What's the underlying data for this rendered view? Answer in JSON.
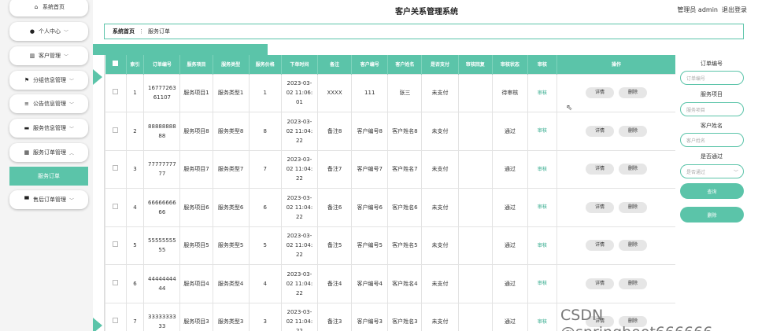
{
  "header": {
    "title": "客户关系管理系统",
    "user_label": "管理员 admin",
    "logout": "退出登录"
  },
  "sidebar": {
    "items": [
      {
        "icon": "home-icon",
        "label": "系统首页",
        "chevron": ""
      },
      {
        "icon": "user-icon",
        "label": "个人中心",
        "chevron": "﹀"
      },
      {
        "icon": "customer-icon",
        "label": "客户管理",
        "chevron": "﹀"
      },
      {
        "icon": "flag-icon",
        "label": "分组信息管理",
        "chevron": "﹀"
      },
      {
        "icon": "list-icon",
        "label": "公告信息管理",
        "chevron": "﹀"
      },
      {
        "icon": "monitor-icon",
        "label": "服务信息管理",
        "chevron": "﹀"
      },
      {
        "icon": "grid-icon",
        "label": "服务订单管理",
        "chevron": "︿"
      },
      {
        "icon": "bag-icon",
        "label": "售后订单管理",
        "chevron": "﹀"
      }
    ],
    "active_sub": "服务订单"
  },
  "breadcrumb": {
    "home": "系统首页",
    "sep": "⋮",
    "current": "服务订单"
  },
  "table": {
    "columns": [
      "索引",
      "订单编号",
      "服务项目",
      "服务类型",
      "服务价格",
      "下单时间",
      "备注",
      "客户编号",
      "客户姓名",
      "是否支付",
      "审核回复",
      "审核状态",
      "审核",
      "操作"
    ],
    "review_link": "审核",
    "detail_btn": "详情",
    "delete_btn": "删除",
    "rows": [
      {
        "idx": "1",
        "order_no": [
          "16777263",
          "61107"
        ],
        "item": "服务项目1",
        "type": "服务类型1",
        "price": "1",
        "time": [
          "2023-03-",
          "02 11:06:",
          "01"
        ],
        "note": "XXXX",
        "cust_no": "111",
        "cust_name": "张三",
        "paid": "未支付",
        "reply": "",
        "status": "待审核"
      },
      {
        "idx": "2",
        "order_no": [
          "88888888",
          "88"
        ],
        "item": "服务项目8",
        "type": "服务类型8",
        "price": "8",
        "time": [
          "2023-03-",
          "02 11:04:",
          "22"
        ],
        "note": "备注8",
        "cust_no": "客户编号8",
        "cust_name": "客户姓名8",
        "paid": "未支付",
        "reply": "",
        "status": "通过"
      },
      {
        "idx": "3",
        "order_no": [
          "77777777",
          "77"
        ],
        "item": "服务项目7",
        "type": "服务类型7",
        "price": "7",
        "time": [
          "2023-03-",
          "02 11:04:",
          "22"
        ],
        "note": "备注7",
        "cust_no": "客户编号7",
        "cust_name": "客户姓名7",
        "paid": "未支付",
        "reply": "",
        "status": "通过"
      },
      {
        "idx": "4",
        "order_no": [
          "66666666",
          "66"
        ],
        "item": "服务项目6",
        "type": "服务类型6",
        "price": "6",
        "time": [
          "2023-03-",
          "02 11:04:",
          "22"
        ],
        "note": "备注6",
        "cust_no": "客户编号6",
        "cust_name": "客户姓名6",
        "paid": "未支付",
        "reply": "",
        "status": "通过"
      },
      {
        "idx": "5",
        "order_no": [
          "55555555",
          "55"
        ],
        "item": "服务项目5",
        "type": "服务类型5",
        "price": "5",
        "time": [
          "2023-03-",
          "02 11:04:",
          "22"
        ],
        "note": "备注5",
        "cust_no": "客户编号5",
        "cust_name": "客户姓名5",
        "paid": "未支付",
        "reply": "",
        "status": "通过"
      },
      {
        "idx": "6",
        "order_no": [
          "44444444",
          "44"
        ],
        "item": "服务项目4",
        "type": "服务类型4",
        "price": "4",
        "time": [
          "2023-03-",
          "02 11:04:",
          "22"
        ],
        "note": "备注4",
        "cust_no": "客户编号4",
        "cust_name": "客户姓名4",
        "paid": "未支付",
        "reply": "",
        "status": "通过"
      },
      {
        "idx": "7",
        "order_no": [
          "33333333",
          "33"
        ],
        "item": "服务项目3",
        "type": "服务类型3",
        "price": "3",
        "time": [
          "2023-03-",
          "02 11:04:",
          "22"
        ],
        "note": "备注3",
        "cust_no": "客户编号3",
        "cust_name": "客户姓名3",
        "paid": "未支付",
        "reply": "",
        "status": "通过"
      }
    ]
  },
  "search": {
    "order_no_label": "订单编号",
    "order_no_placeholder": "订单编号",
    "item_label": "服务项目",
    "item_placeholder": "服务项目",
    "cust_name_label": "客户姓名",
    "cust_name_placeholder": "客户姓名",
    "paid_label": "是否通过",
    "paid_placeholder": "是否通过",
    "query_btn": "查询",
    "delete_btn": "删除"
  },
  "watermark": "CSDN @springboot666666",
  "colors": {
    "accent": "#5bc4a9",
    "link": "#2ba889"
  }
}
